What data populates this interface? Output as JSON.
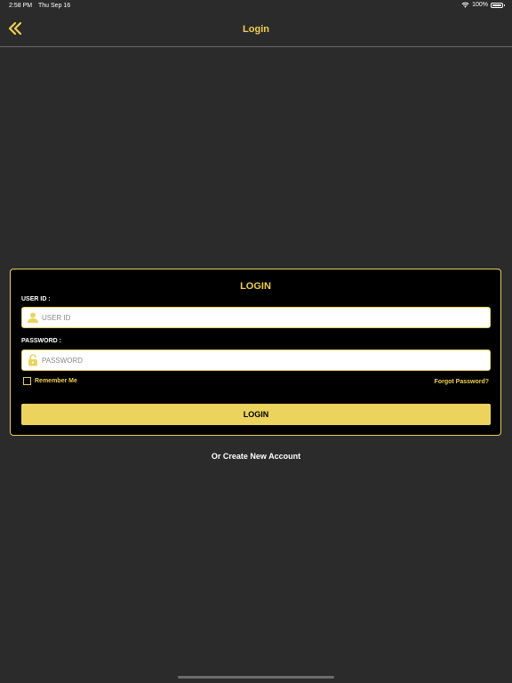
{
  "status_bar": {
    "time": "2:58 PM",
    "date": "Thu Sep 16",
    "battery": "100%"
  },
  "nav": {
    "title": "Login",
    "back_icon": "double-chevron-left-icon"
  },
  "login_card": {
    "title": "LOGIN",
    "user_id_label": "USER ID :",
    "user_id_placeholder": "USER ID",
    "user_id_value": "",
    "user_icon": "user-icon",
    "password_label": "PASSWORD :",
    "password_placeholder": "PASSWORD",
    "password_value": "",
    "lock_icon": "lock-icon",
    "remember_me_label": "Remember Me",
    "remember_me_checked": false,
    "forgot_password_label": "Forgot Password?",
    "login_button_label": "LOGIN"
  },
  "create_account_label": "Or Create New Account",
  "colors": {
    "background": "#2b2b2b",
    "card_background": "#000000",
    "accent": "#f0d050",
    "button": "#ecd35e"
  }
}
